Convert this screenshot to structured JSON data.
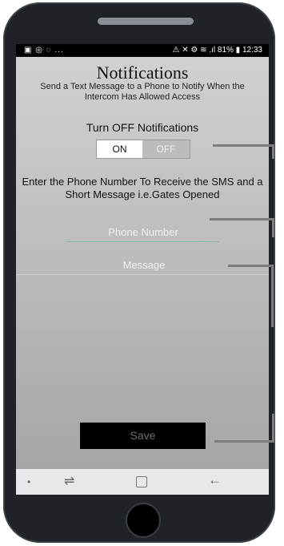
{
  "status_bar": {
    "left_icons": "▣ ◎ ◌ ...",
    "right_text": "⚠ ✕ ⚙ ≋ .ıl 81% ▮ 12:33",
    "battery": "81%",
    "time": "12:33"
  },
  "page": {
    "title": "Notifications",
    "subtitle": "Send a Text Message to a Phone to Notify When the Intercom Has Allowed Access"
  },
  "notification_toggle": {
    "heading": "Turn OFF Notifications",
    "on_label": "ON",
    "off_label": "OFF"
  },
  "instructions": "Enter the Phone Number To Receive the SMS and a Short Message i.e.Gates Opened",
  "phone_number": {
    "placeholder": "Phone Number",
    "value": ""
  },
  "message": {
    "placeholder": "Message",
    "value": ""
  },
  "save_label": "Save",
  "navbar": {
    "dot": "•",
    "recent": "⇌",
    "back": "←"
  }
}
